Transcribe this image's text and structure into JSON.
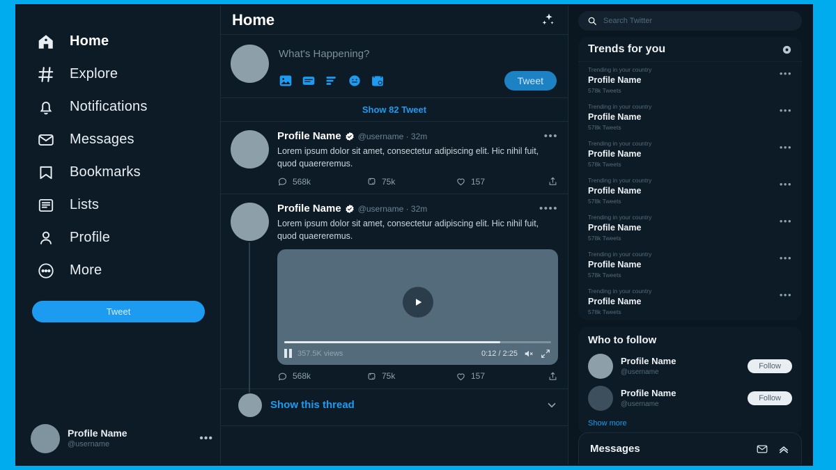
{
  "colors": {
    "frame": "#00aced",
    "accent": "#1d9bf0",
    "app_bg": "#0d1b26",
    "rail_bg": "#0a1720",
    "divider": "#1c2d3a"
  },
  "sidebar": {
    "items": [
      {
        "label": "Home",
        "icon": "home-icon",
        "active": true
      },
      {
        "label": "Explore",
        "icon": "hashtag-icon",
        "active": false
      },
      {
        "label": "Notifications",
        "icon": "bell-icon",
        "active": false
      },
      {
        "label": "Messages",
        "icon": "envelope-icon",
        "active": false
      },
      {
        "label": "Bookmarks",
        "icon": "bookmark-icon",
        "active": false
      },
      {
        "label": "Lists",
        "icon": "list-icon",
        "active": false
      },
      {
        "label": "Profile",
        "icon": "person-icon",
        "active": false
      },
      {
        "label": "More",
        "icon": "more-circle-icon",
        "active": false
      }
    ],
    "tweet_button": "Tweet",
    "profile": {
      "name": "Profile Name",
      "handle": "@username",
      "menu": "•••"
    }
  },
  "feed": {
    "header_title": "Home",
    "header_icon": "sparkle-icon",
    "compose": {
      "placeholder": "What's Happening?",
      "tweet_button": "Tweet",
      "media_icons": [
        "image-icon",
        "gif-icon",
        "poll-icon",
        "emoji-icon",
        "schedule-icon"
      ]
    },
    "show_tweets_label": "Show 82 Tweet",
    "tweets": [
      {
        "name": "Profile Name",
        "verified": true,
        "meta": "@username · 32m",
        "menu": "•••",
        "text": "Lorem ipsum dolor sit amet, consectetur adipiscing elit. Hic nihil fuit, quod quaereremus.",
        "replies": "568k",
        "retweets": "75k",
        "likes": "157",
        "has_video": false,
        "has_thread": false
      },
      {
        "name": "Profile Name",
        "verified": true,
        "meta": "@username · 32m",
        "menu": "••••",
        "text": "Lorem ipsum dolor sit amet, consectetur adipiscing elit. Hic nihil fuit, quod quaereremus.",
        "replies": "568k",
        "retweets": "75k",
        "likes": "157",
        "has_video": true,
        "has_thread": true,
        "video": {
          "views": "357.5K views",
          "time": "0:12 / 2:25",
          "progress_percent": 81
        }
      }
    ],
    "thread_link": "Show this thread"
  },
  "rail": {
    "search": {
      "placeholder": "Search Twitter",
      "icon": "search-icon"
    },
    "trends": {
      "title": "Trends for you",
      "settings_icon": "gear-icon",
      "items": [
        {
          "sub": "Trending in your country",
          "name": "Profile Name",
          "count": "578k Tweets",
          "menu": "•••"
        },
        {
          "sub": "Trending in your country",
          "name": "Profile Name",
          "count": "578k Tweets",
          "menu": "•••"
        },
        {
          "sub": "Trending in your country",
          "name": "Profile Name",
          "count": "578k Tweets",
          "menu": "•••"
        },
        {
          "sub": "Trending in your country",
          "name": "Profile Name",
          "count": "578k Tweets",
          "menu": "•••"
        },
        {
          "sub": "Trending in your country",
          "name": "Profile Name",
          "count": "578k Tweets",
          "menu": "•••"
        },
        {
          "sub": "Trending in your country",
          "name": "Profile Name",
          "count": "578k Tweets",
          "menu": "•••"
        },
        {
          "sub": "Trending in your country",
          "name": "Profile Name",
          "count": "578k Tweets",
          "menu": "•••"
        }
      ]
    },
    "who_to_follow": {
      "title": "Who to follow",
      "people": [
        {
          "name": "Profile Name",
          "handle": "@username",
          "follow_label": "Follow"
        },
        {
          "name": "Profile Name",
          "handle": "@username",
          "follow_label": "Follow"
        }
      ],
      "show_more": "Show more"
    },
    "messages_dock": {
      "title": "Messages",
      "icons": [
        "new-message-icon",
        "chevron-up-icon"
      ]
    }
  }
}
